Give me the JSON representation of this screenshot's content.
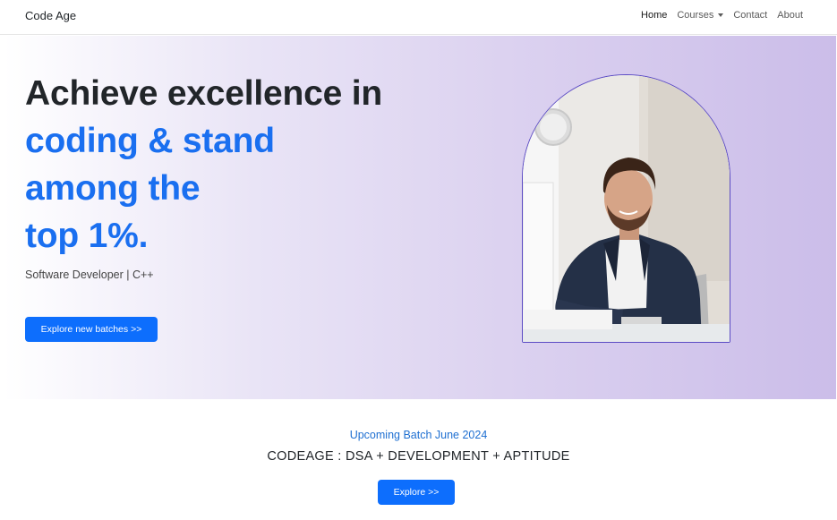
{
  "nav": {
    "brand": "Code Age",
    "items": [
      {
        "label": "Home"
      },
      {
        "label": "Courses"
      },
      {
        "label": "Contact"
      },
      {
        "label": "About"
      }
    ]
  },
  "hero": {
    "headline_line1": "Achieve excellence in",
    "headline_line2": "coding & stand",
    "headline_line3": "among the",
    "headline_line4": "top 1%.",
    "subtitle": "Software Developer | C++",
    "cta_label": "Explore new batches >>"
  },
  "batch": {
    "upcoming": "Upcoming Batch June 2024",
    "tagline": "CODEAGE : DSA + DEVELOPMENT + APTITUDE",
    "cta_label": "Explore >>"
  },
  "colors": {
    "primary": "#0d6efd",
    "headline_blue": "#1a6ff0",
    "hero_gradient_end": "#cbbde9"
  }
}
